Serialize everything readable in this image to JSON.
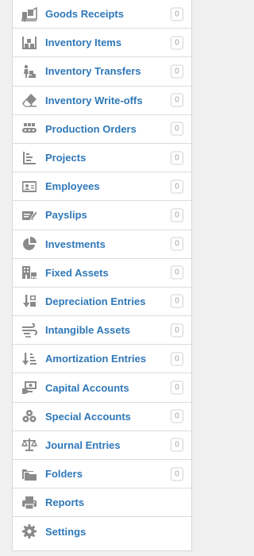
{
  "colors": {
    "label": "#2f78b8",
    "icon": "#8a8a8a",
    "badge_text": "#a3a3a3",
    "border": "#dcdcdc",
    "background": "#f0f0f0"
  },
  "menu": {
    "items": [
      {
        "label": "Goods Receipts",
        "icon": "goods-receipts-icon",
        "count": "0"
      },
      {
        "label": "Inventory Items",
        "icon": "inventory-items-icon",
        "count": "0"
      },
      {
        "label": "Inventory Transfers",
        "icon": "inventory-transfers-icon",
        "count": "0"
      },
      {
        "label": "Inventory Write-offs",
        "icon": "eraser-icon",
        "count": "0"
      },
      {
        "label": "Production Orders",
        "icon": "production-orders-icon",
        "count": "0"
      },
      {
        "label": "Projects",
        "icon": "projects-icon",
        "count": "0"
      },
      {
        "label": "Employees",
        "icon": "id-card-icon",
        "count": "0"
      },
      {
        "label": "Payslips",
        "icon": "payslip-icon",
        "count": "0"
      },
      {
        "label": "Investments",
        "icon": "pie-chart-icon",
        "count": "0"
      },
      {
        "label": "Fixed Assets",
        "icon": "building-icon",
        "count": "0"
      },
      {
        "label": "Depreciation Entries",
        "icon": "sort-down-icon",
        "count": "0"
      },
      {
        "label": "Intangible Assets",
        "icon": "wind-icon",
        "count": "0"
      },
      {
        "label": "Amortization Entries",
        "icon": "sort-amount-down-icon",
        "count": "0"
      },
      {
        "label": "Capital Accounts",
        "icon": "money-icon",
        "count": "0"
      },
      {
        "label": "Special Accounts",
        "icon": "cubes-icon",
        "count": "0"
      },
      {
        "label": "Journal Entries",
        "icon": "scale-icon",
        "count": "0"
      },
      {
        "label": "Folders",
        "icon": "folders-icon",
        "count": "0"
      },
      {
        "label": "Reports",
        "icon": "printer-icon",
        "count": ""
      },
      {
        "label": "Settings",
        "icon": "gear-icon",
        "count": ""
      }
    ]
  }
}
